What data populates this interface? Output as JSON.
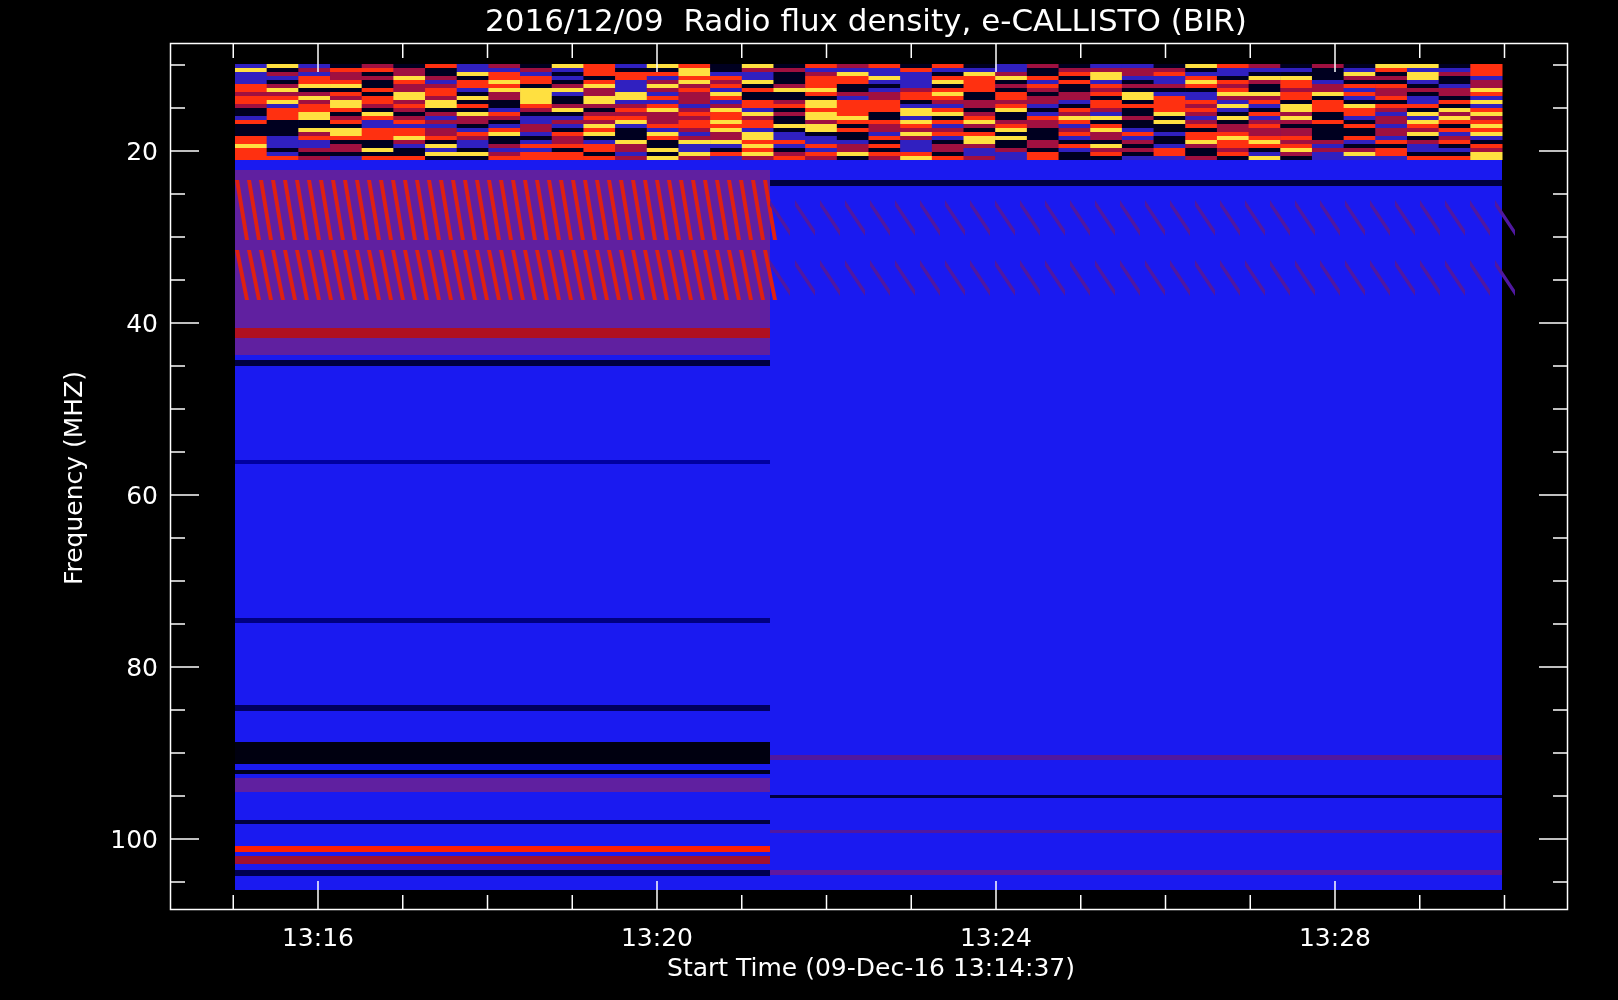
{
  "title": "2016/12/09  Radio flux density, e-CALLISTO (BIR)",
  "y_axis": {
    "label": "Frequency (MHZ)",
    "ticks": [
      "20",
      "40",
      "60",
      "80",
      "100"
    ]
  },
  "x_axis": {
    "label": "Start Time (09-Dec-16 13:14:37)",
    "ticks": [
      "13:16",
      "13:20",
      "13:24",
      "13:28"
    ]
  }
}
